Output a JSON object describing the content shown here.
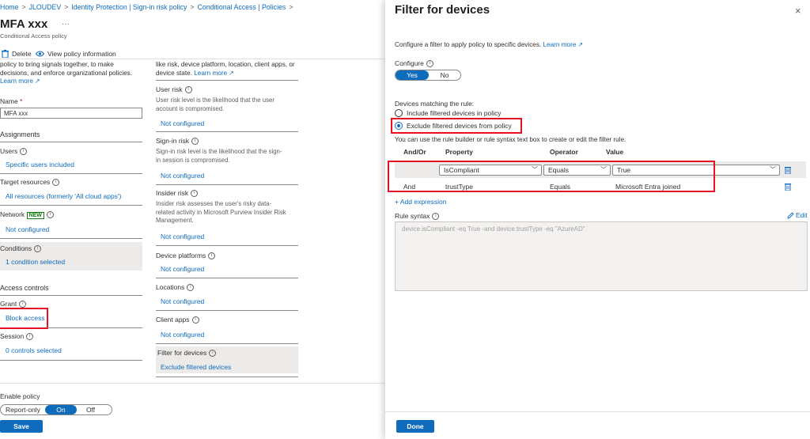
{
  "breadcrumb": [
    "Home",
    "JLOUDEV",
    "Identity Protection | Sign-in risk policy",
    "Conditional Access | Policies"
  ],
  "breadcrumb_sep": ">",
  "page": {
    "title": "MFA xxx",
    "more": "···",
    "subtitle": "Conditional Access policy"
  },
  "toolbar": {
    "delete_label": "Delete",
    "view_label": "View policy information"
  },
  "left": {
    "intro_lines": [
      "policy to bring signals together, to make",
      "decisions, and enforce organizational policies."
    ],
    "learn_more": "Learn more",
    "name_label": "Name",
    "required_mark": "*",
    "name_value": "MFA xxx",
    "assignments_title": "Assignments",
    "users_label": "Users",
    "users_value": "Specific users included",
    "target_label": "Target resources",
    "target_value": "All resources (formerly 'All cloud apps')",
    "network_label": "Network",
    "network_badge": "NEW",
    "network_value": "Not configured",
    "conditions_label": "Conditions",
    "conditions_value": "1 condition selected",
    "access_title": "Access controls",
    "grant_label": "Grant",
    "grant_value": "Block access",
    "session_label": "Session",
    "session_value": "0 controls selected",
    "enable_label": "Enable policy",
    "enable_options": [
      "Report-only",
      "On",
      "Off"
    ],
    "save_label": "Save"
  },
  "middle": {
    "intro_lines": [
      "like risk, device platform, location, client apps, or",
      "device state."
    ],
    "learn_more": "Learn more",
    "user_risk_label": "User risk",
    "user_risk_desc": [
      "User risk level is the likelihood that the user",
      "account is compromised."
    ],
    "user_risk_value": "Not configured",
    "signin_risk_label": "Sign-in risk",
    "signin_risk_desc": [
      "Sign-in risk level is the likelihood that the sign-",
      "in session is compromised."
    ],
    "signin_risk_value": "Not configured",
    "insider_label": "Insider risk",
    "insider_desc": [
      "Insider risk assesses the user's risky data-",
      "related activity in Microsoft Purview Insider Risk",
      "Management."
    ],
    "insider_value": "Not configured",
    "platforms_label": "Device platforms",
    "platforms_value": "Not configured",
    "locations_label": "Locations",
    "locations_value": "Not configured",
    "client_apps_label": "Client apps",
    "client_apps_value": "Not configured",
    "filter_label": "Filter for devices",
    "filter_value": "Exclude filtered devices"
  },
  "panel": {
    "title": "Filter for devices",
    "close": "×",
    "intro": "Configure a filter to apply policy to specific devices.",
    "learn_more": "Learn more",
    "configure_label": "Configure",
    "configure_options": [
      "Yes",
      "No"
    ],
    "matching_label": "Devices matching the rule:",
    "include_label": "Include filtered devices in policy",
    "exclude_label": "Exclude filtered devices from policy",
    "builder_hint": "You can use the rule builder or rule syntax text box to create or edit the filter rule.",
    "columns": [
      "And/Or",
      "Property",
      "Operator",
      "Value"
    ],
    "rows": [
      {
        "andor": "",
        "property": "IsCompliant",
        "operator": "Equals",
        "value": "True"
      },
      {
        "andor": "And",
        "property": "trustType",
        "operator": "Equals",
        "value": "Microsoft Entra joined"
      }
    ],
    "add_expression": "+ Add expression",
    "rule_syntax_label": "Rule syntax",
    "edit_label": "Edit",
    "rule_syntax_value": "device.isCompliant -eq True -and device.trustType -eq \"AzureAD\"",
    "done_label": "Done"
  },
  "colors": {
    "accent": "#0f6cbd",
    "highlight_box": "#e81123",
    "panel_bg": "#ffffff",
    "selected_row_bg": "#edebe9"
  }
}
